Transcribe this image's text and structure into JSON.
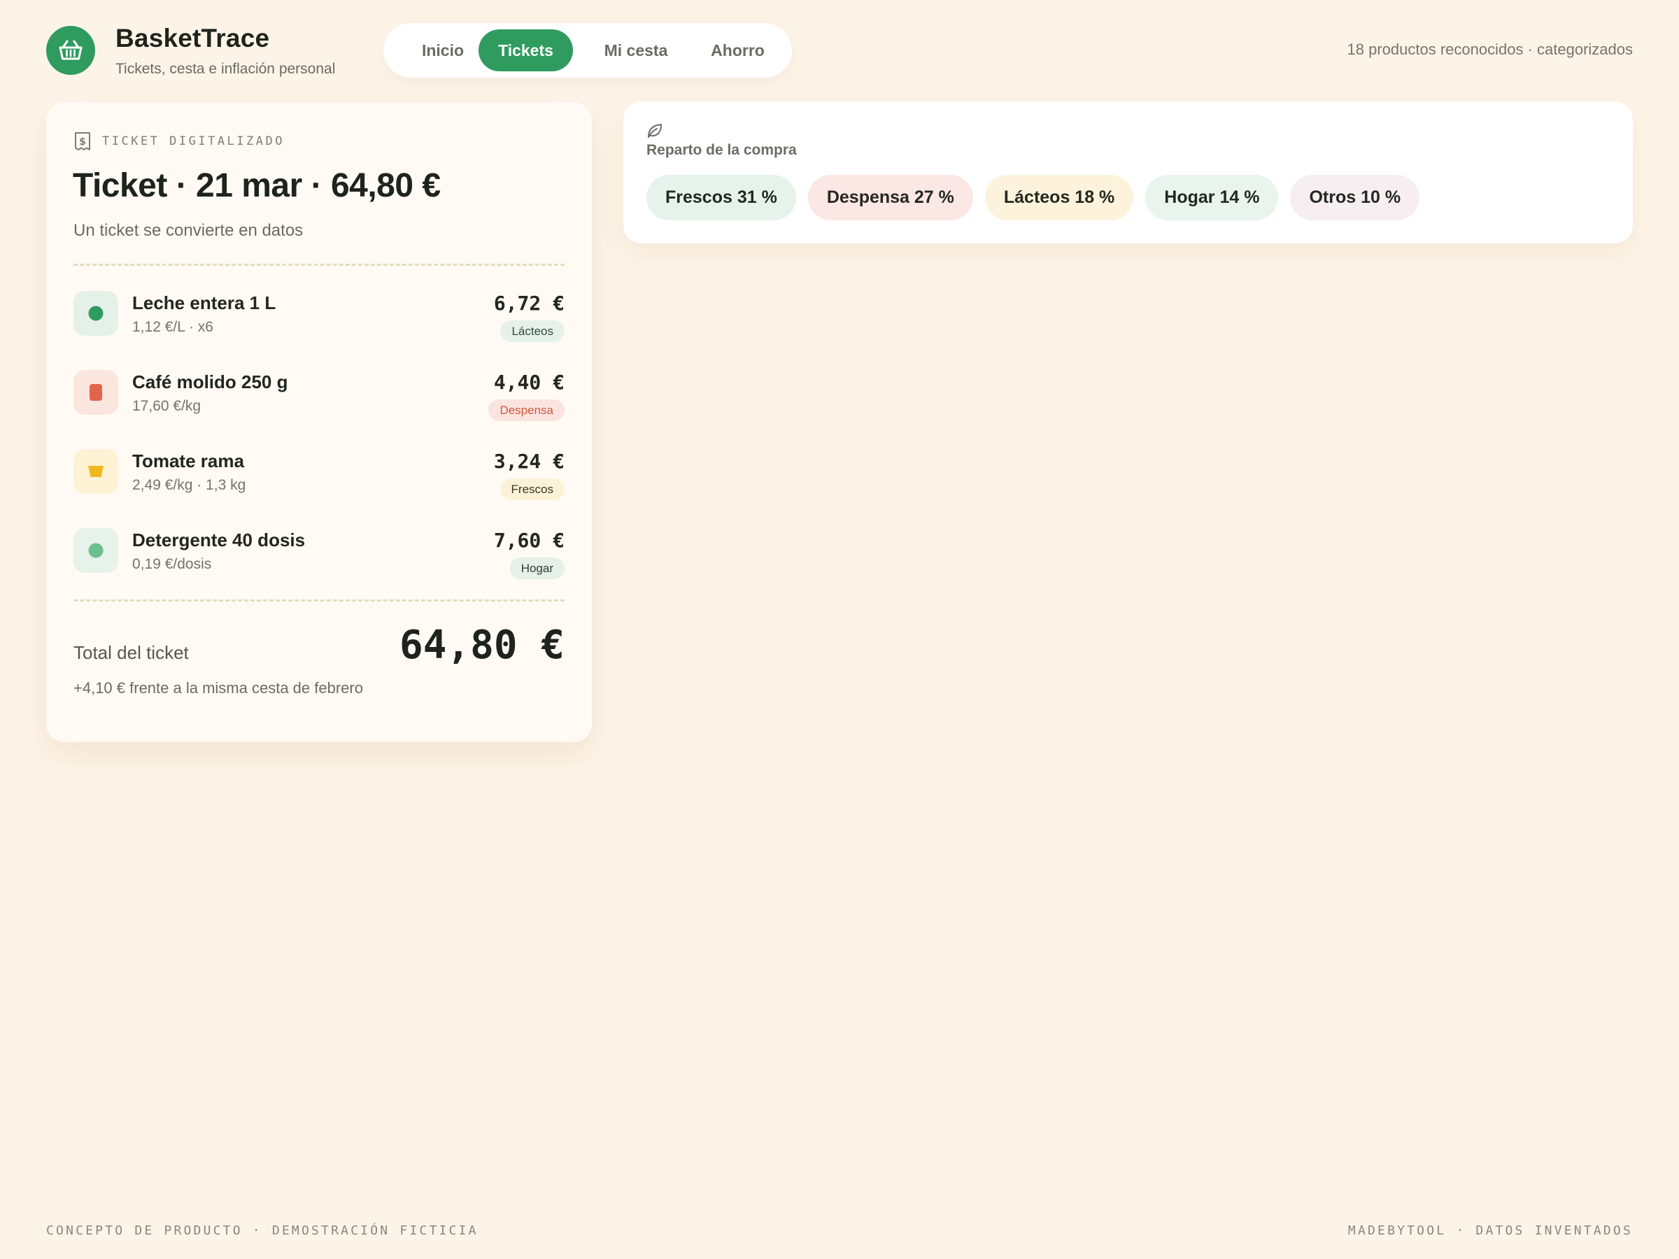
{
  "app": {
    "name": "BasketTrace",
    "tagline": "Tickets, cesta e inflación personal",
    "logo_icon": "basket-icon",
    "accent": "#2f9b5f"
  },
  "nav": {
    "tabs": [
      {
        "label": "Inicio",
        "active": false
      },
      {
        "label": "Tickets",
        "active": true
      },
      {
        "label": "Mi cesta",
        "active": false
      },
      {
        "label": "Ahorro",
        "active": false
      }
    ]
  },
  "header_status": "18 productos reconocidos · categorizados",
  "ticket": {
    "kicker": "TICKET DIGITALIZADO",
    "kicker_icon": "receipt-icon",
    "title": "Ticket · 21 mar · 64,80 €",
    "subtitle": "Un ticket se convierte en datos",
    "items": [
      {
        "name": "Leche entera 1 L",
        "detail": "1,12 €/L · x6",
        "price": "6,72 €",
        "category": "Lácteos",
        "icon": "dot-icon",
        "icon_color": "#2f9b5f",
        "icon_bg": "#e4f1e8",
        "badge_bg": "#e6f1e9",
        "badge_color": "#2e4a37"
      },
      {
        "name": "Café molido 250 g",
        "detail": "17,60 €/kg",
        "price": "4,40 €",
        "category": "Despensa",
        "icon": "square-icon",
        "icon_color": "#e2654b",
        "icon_bg": "#fbe6df",
        "badge_bg": "#fbe4df",
        "badge_color": "#d0573e"
      },
      {
        "name": "Tomate rama",
        "detail": "2,49 €/kg · 1,3 kg",
        "price": "3,24 €",
        "category": "Frescos",
        "icon": "cup-icon",
        "icon_color": "#f0b81f",
        "icon_bg": "#fdf2d4",
        "badge_bg": "#fcf2d8",
        "badge_color": "#3b3624"
      },
      {
        "name": "Detergente 40 dosis",
        "detail": "0,19 €/dosis",
        "price": "7,60 €",
        "category": "Hogar",
        "icon": "dot-icon",
        "icon_color": "#6cc08d",
        "icon_bg": "#e6f2ea",
        "badge_bg": "#e4f0e8",
        "badge_color": "#2e3d33"
      }
    ],
    "total_label": "Total del ticket",
    "total_value": "64,80 €",
    "comparison": "+4,10 € frente a la misma cesta de febrero"
  },
  "breakdown": {
    "icon": "leaf-icon",
    "title": "Reparto de la compra",
    "chips": [
      {
        "label": "Frescos 31 %",
        "bg": "#e5f3ea"
      },
      {
        "label": "Despensa 27 %",
        "bg": "#fbe7e3"
      },
      {
        "label": "Lácteos 18 %",
        "bg": "#fdf3dc"
      },
      {
        "label": "Hogar 14 %",
        "bg": "#e8f4ec"
      },
      {
        "label": "Otros 10 %",
        "bg": "#f6eef0"
      }
    ]
  },
  "footer": {
    "left": "CONCEPTO DE PRODUCTO · DEMOSTRACIÓN FICTICIA",
    "right": "MADEBYTOOL · DATOS INVENTADOS"
  }
}
